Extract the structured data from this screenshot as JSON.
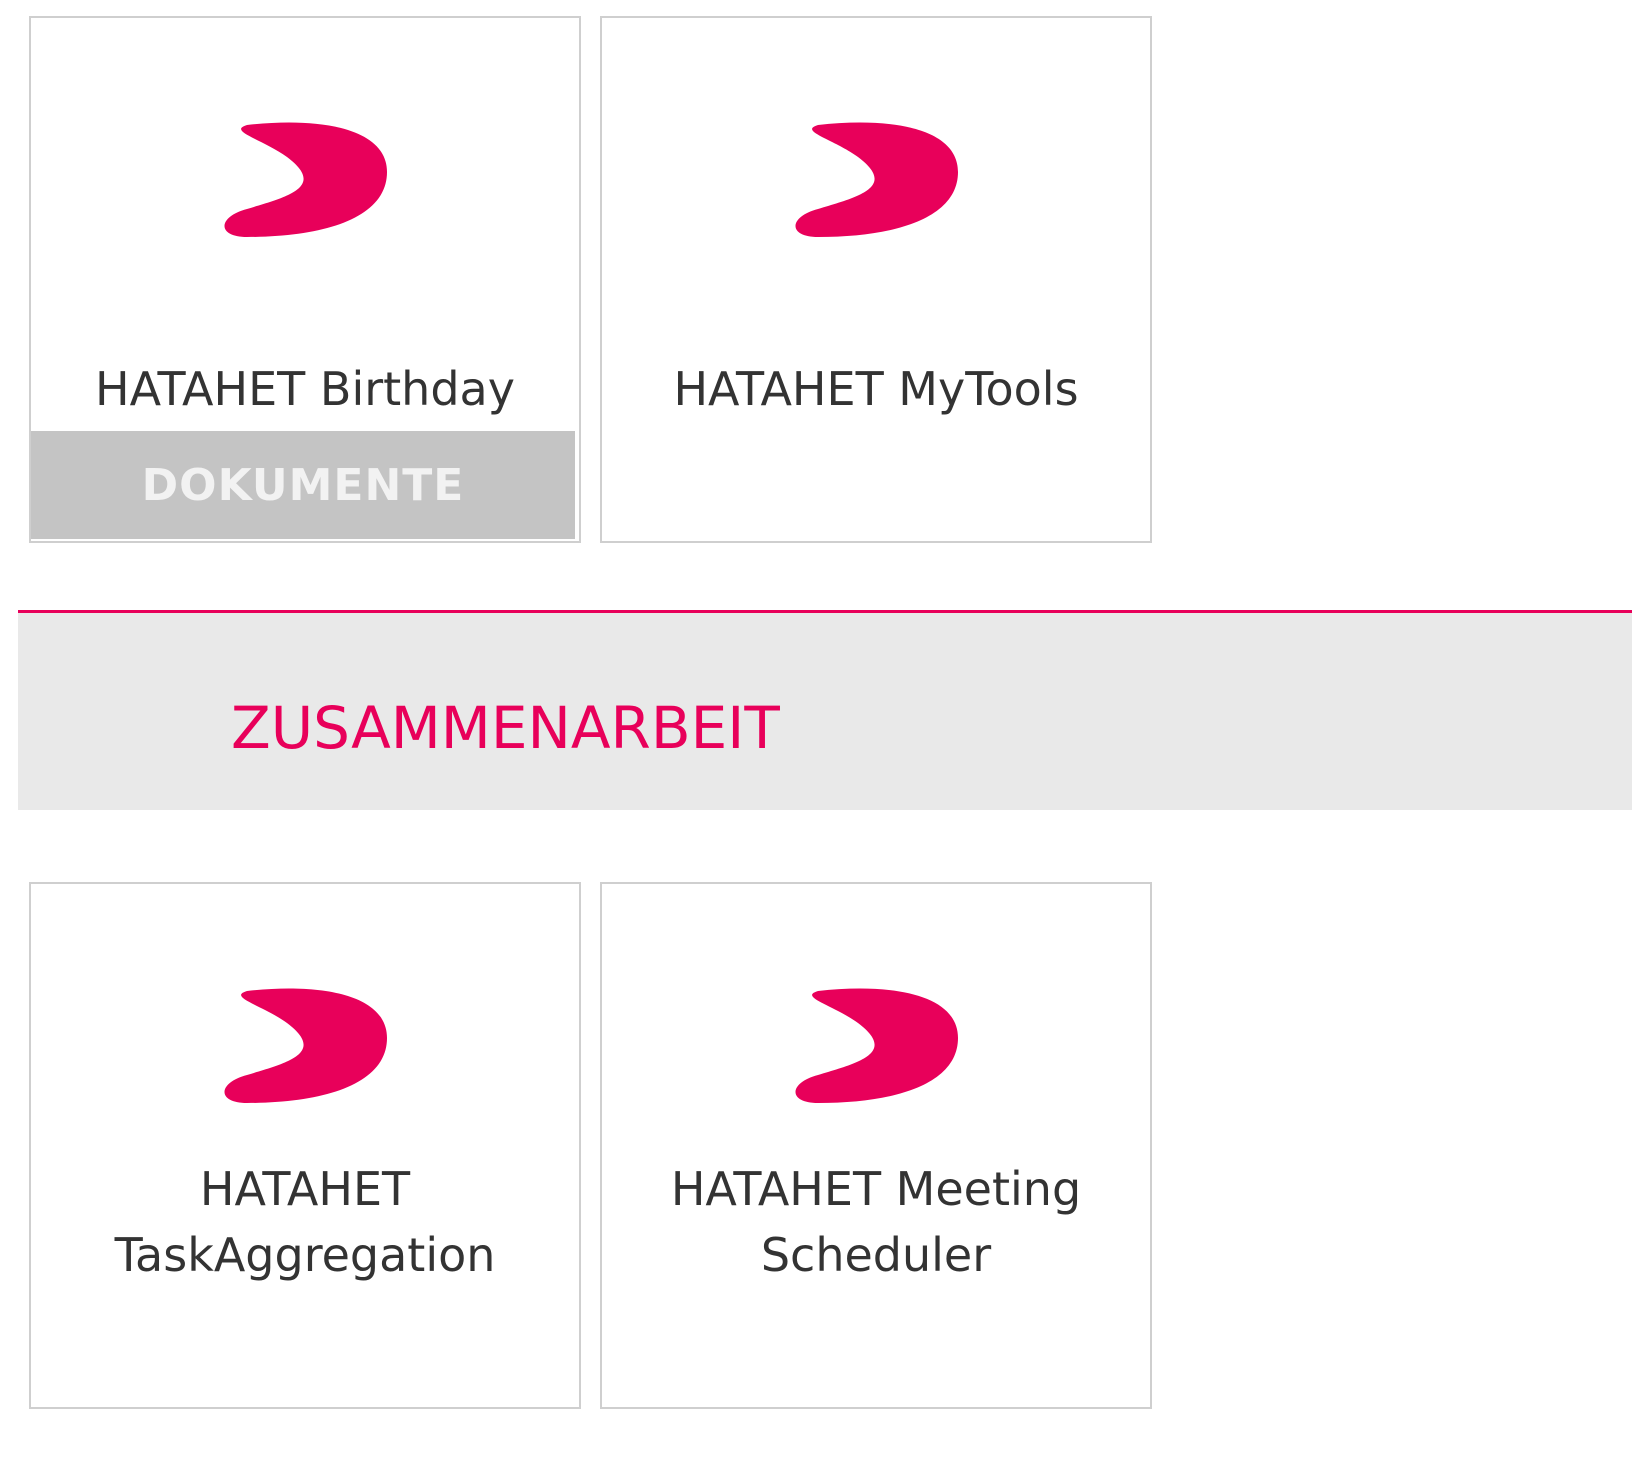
{
  "colors": {
    "accent": "#e8005a",
    "tile_border": "#cfcfcf",
    "footer_bg": "#c4c4c4",
    "section_bg": "#e9e9e9",
    "text": "#333333"
  },
  "top_tiles": [
    {
      "title": "HATAHET Birthday",
      "icon": "hatahet-logo-icon",
      "footer": "DOKUMENTE"
    },
    {
      "title": "HATAHET MyTools",
      "icon": "hatahet-logo-icon"
    }
  ],
  "section": {
    "title": "ZUSAMMENARBEIT"
  },
  "bottom_tiles": [
    {
      "title_line1": "HATAHET",
      "title_line2": "TaskAggregation",
      "icon": "hatahet-logo-icon"
    },
    {
      "title_line1": "HATAHET Meeting",
      "title_line2": "Scheduler",
      "icon": "hatahet-logo-icon"
    }
  ]
}
